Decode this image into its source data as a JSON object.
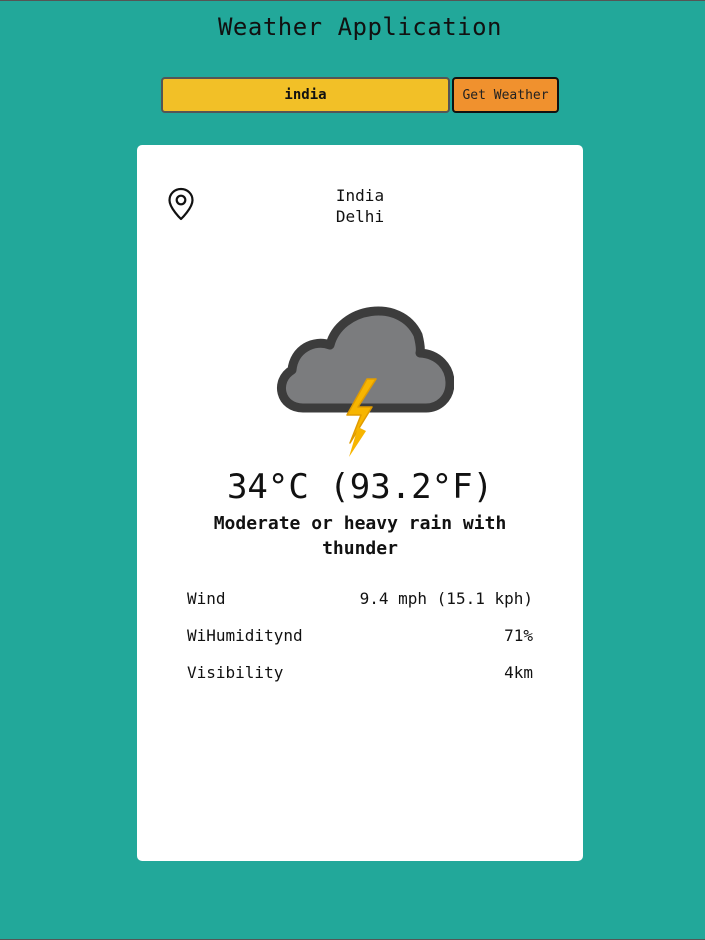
{
  "app": {
    "title": "Weather Application"
  },
  "search": {
    "value": "india",
    "button_label": "Get Weather"
  },
  "location": {
    "icon": "map-pin-icon",
    "country": "India",
    "city": "Delhi"
  },
  "weather": {
    "icon": "thunder-cloud-icon",
    "temperature": "34°C (93.2°F)",
    "condition": "Moderate or heavy rain with thunder"
  },
  "details": [
    {
      "label": "Wind",
      "value": "9.4 mph (15.1 kph)"
    },
    {
      "label": "WiHumiditynd",
      "value": "71%"
    },
    {
      "label": "Visibility",
      "value": "4km"
    }
  ],
  "colors": {
    "background": "#22a89a",
    "input": "#f2c027",
    "button": "#f0912e",
    "card": "#ffffff",
    "cloud": "#7b7c7e",
    "bolt": "#f5a800"
  }
}
